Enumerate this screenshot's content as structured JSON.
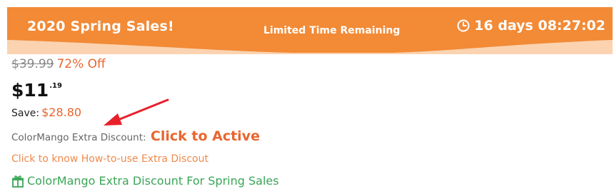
{
  "banner": {
    "title": "2020 Spring Sales!",
    "subtitle": "Limited Time Remaining",
    "timer": "16 days 08:27:02",
    "color": "#f28a36"
  },
  "pricing": {
    "original_price": "$39.99",
    "discount": "72% Off",
    "price_main": "$11",
    "price_cents": ".19",
    "save_label": "Save:",
    "save_amount": "$28.80"
  },
  "extra_discount": {
    "label": "ColorMango Extra Discount:",
    "action": "Click to Active"
  },
  "howto_link": "Click to know How-to-use Extra Discout",
  "promo_link": "ColorMango Extra Discount For Spring Sales",
  "colors": {
    "accent": "#e8662e",
    "promo_green": "#3aa657",
    "arrow_red": "#e8202a"
  }
}
